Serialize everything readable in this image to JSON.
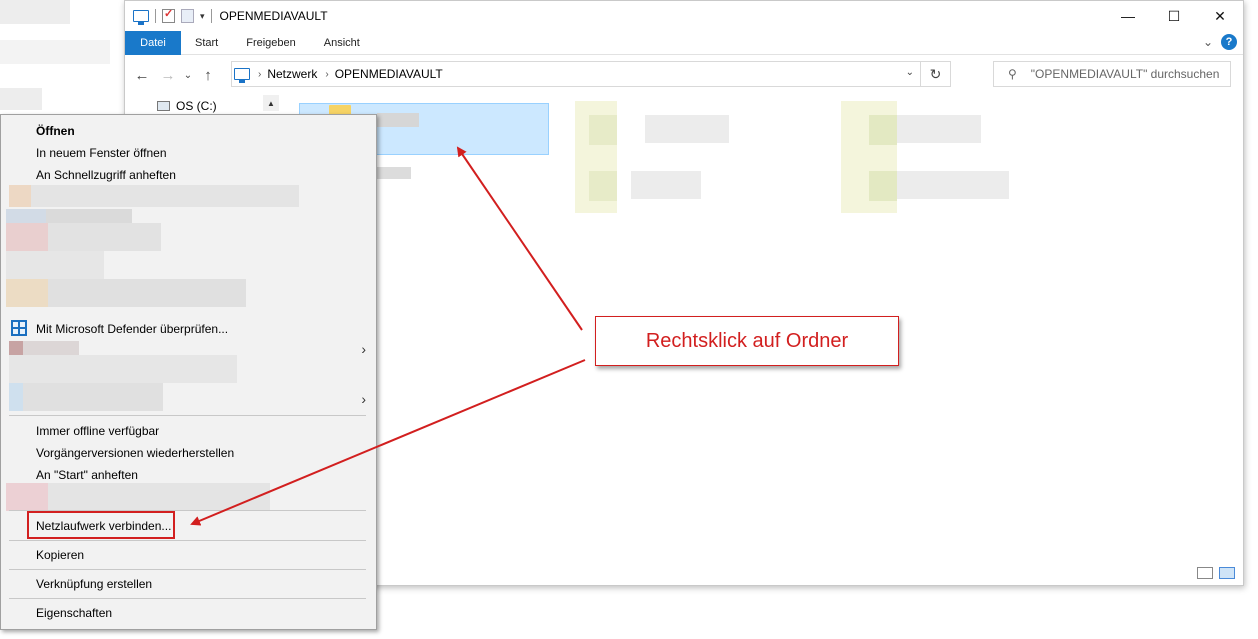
{
  "window": {
    "title": "OPENMEDIAVAULT",
    "min_glyph": "—",
    "max_glyph": "☐",
    "close_glyph": "✕"
  },
  "ribbon": {
    "tabs": [
      "Datei",
      "Start",
      "Freigeben",
      "Ansicht"
    ],
    "help_glyph": "?",
    "expand_glyph": "⌄"
  },
  "nav": {
    "back_glyph": "←",
    "forward_glyph": "→",
    "recent_glyph": "⌄",
    "up_glyph": "↑",
    "breadcrumb": [
      "Netzwerk",
      "OPENMEDIAVAULT"
    ],
    "refresh_glyph": "↻",
    "search_placeholder": "\"OPENMEDIAVAULT\" durchsuchen"
  },
  "navpane": {
    "drive_label": "OS (C:)"
  },
  "context_menu": {
    "items": [
      "Öffnen",
      "In neuem Fenster öffnen",
      "An Schnellzugriff anheften",
      "Mit Microsoft Defender überprüfen...",
      "Immer offline verfügbar",
      "Vorgängerversionen wiederherstellen",
      "An \"Start\" anheften",
      "Netzlaufwerk verbinden...",
      "Kopieren",
      "Verknüpfung erstellen",
      "Eigenschaften"
    ],
    "submenu_glyph": "›"
  },
  "annotation": {
    "text": "Rechtsklick auf Ordner",
    "color": "#d21f1f"
  },
  "icons": {
    "this_pc": "pc-icon",
    "drive": "drive-icon",
    "defender": "defender-shield-icon",
    "folder": "folder-icon"
  }
}
